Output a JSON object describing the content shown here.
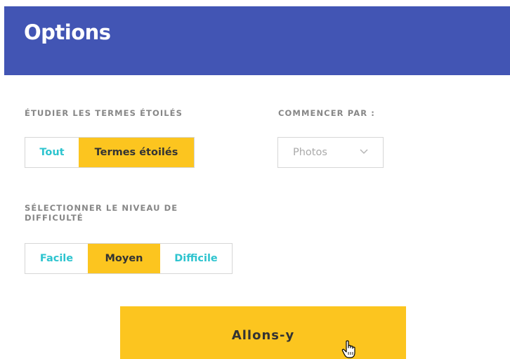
{
  "header": {
    "title": "Options"
  },
  "study_starred": {
    "label": "ÉTUDIER LES TERMES ÉTOILÉS",
    "options": [
      "Tout",
      "Termes étoilés"
    ],
    "selected": "Termes étoilés"
  },
  "start_with": {
    "label": "COMMENCER PAR :",
    "value": "Photos"
  },
  "difficulty": {
    "label_line1": "SÉLECTIONNER LE NIVEAU DE",
    "label_line2": "DIFFICULTÉ",
    "options": [
      "Facile",
      "Moyen",
      "Difficile"
    ],
    "selected": "Moyen"
  },
  "submit": {
    "label": "Allons-y"
  },
  "icons": {
    "dropdown": "chevron-down-icon",
    "cursor": "hand-pointer-cursor-icon"
  },
  "colors": {
    "header": "#4255b4",
    "accent": "#fcc51f",
    "link": "#2ec4cf"
  }
}
